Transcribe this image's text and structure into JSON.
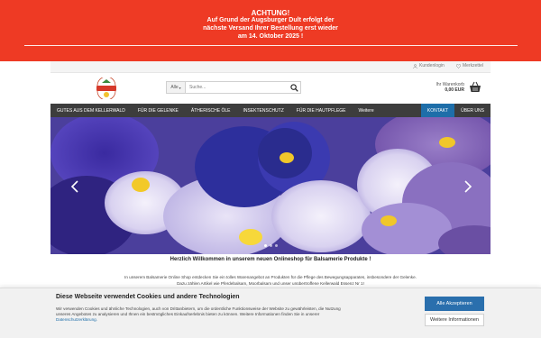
{
  "alert": {
    "title": "ACHTUNG!",
    "line1": "Auf Grund der Augsburger Dult erfolgt der",
    "line2": "nächste Versand Ihrer Bestellung erst wieder",
    "line3": "am 14. Oktober 2025 !"
  },
  "topbar": {
    "account_label": "Kundenlogin",
    "wishlist_label": "Merkzettel"
  },
  "logo": {
    "text_top": "NATURPRODUKTE",
    "text_main": "BALSAMERIE",
    "text_bottom": "KELLERWALD"
  },
  "search": {
    "category_label": "Alle",
    "placeholder": "Suche..."
  },
  "cart": {
    "label": "Ihr Warenkorb",
    "amount": "0,00 EUR"
  },
  "nav": {
    "items": [
      "GUTES AUS DEM KELLERWALD",
      "FÜR DIE GELENKE",
      "ÄTHERISCHE ÖLE",
      "INSEKTENSCHUTZ",
      "FÜR DIE HAUTPFLEGE",
      "Weitere"
    ],
    "contact": "KONTAKT",
    "about": "ÜBER UNS"
  },
  "hero": {
    "slide_count": 3,
    "active_slide": 1
  },
  "welcome": {
    "heading": "Herzlich Willkommen in unserem neuen Onlineshop für Balsamerie Produkte !",
    "intro1": "In unserem Balsamerie Online Shop entdecken Sie ein tolles Warenangebot an Produkten für die Pflege des Bewegungsapparates, insbesondere der Gelenke.",
    "intro2": "Dazu zählen Artikel wie Pferdebalsam, Moorbalsam und unser unübertroffene Kellerwald Essenz Nr 1!"
  },
  "cookie": {
    "title": "Diese Webseite verwendet Cookies und andere Technologien",
    "text": "Wir verwenden Cookies und ähnliche Technologien, auch von Drittanbietern, um die ordentliche Funktionsweise der Website zu gewährleisten, die Nutzung unseres Angebotes zu analysieren und Ihnen ein bestmögliches Einkaufserlebnis bieten zu können. Weitere Informationen finden Sie in unserer",
    "link": "Datenschutzerklärung.",
    "accept": "Alle Akzeptieren",
    "more": "Weitere Informationen"
  },
  "colors": {
    "alert_red": "#ee3a24",
    "nav_dark": "#3d3d3d",
    "accent_blue": "#1e6ea9"
  }
}
